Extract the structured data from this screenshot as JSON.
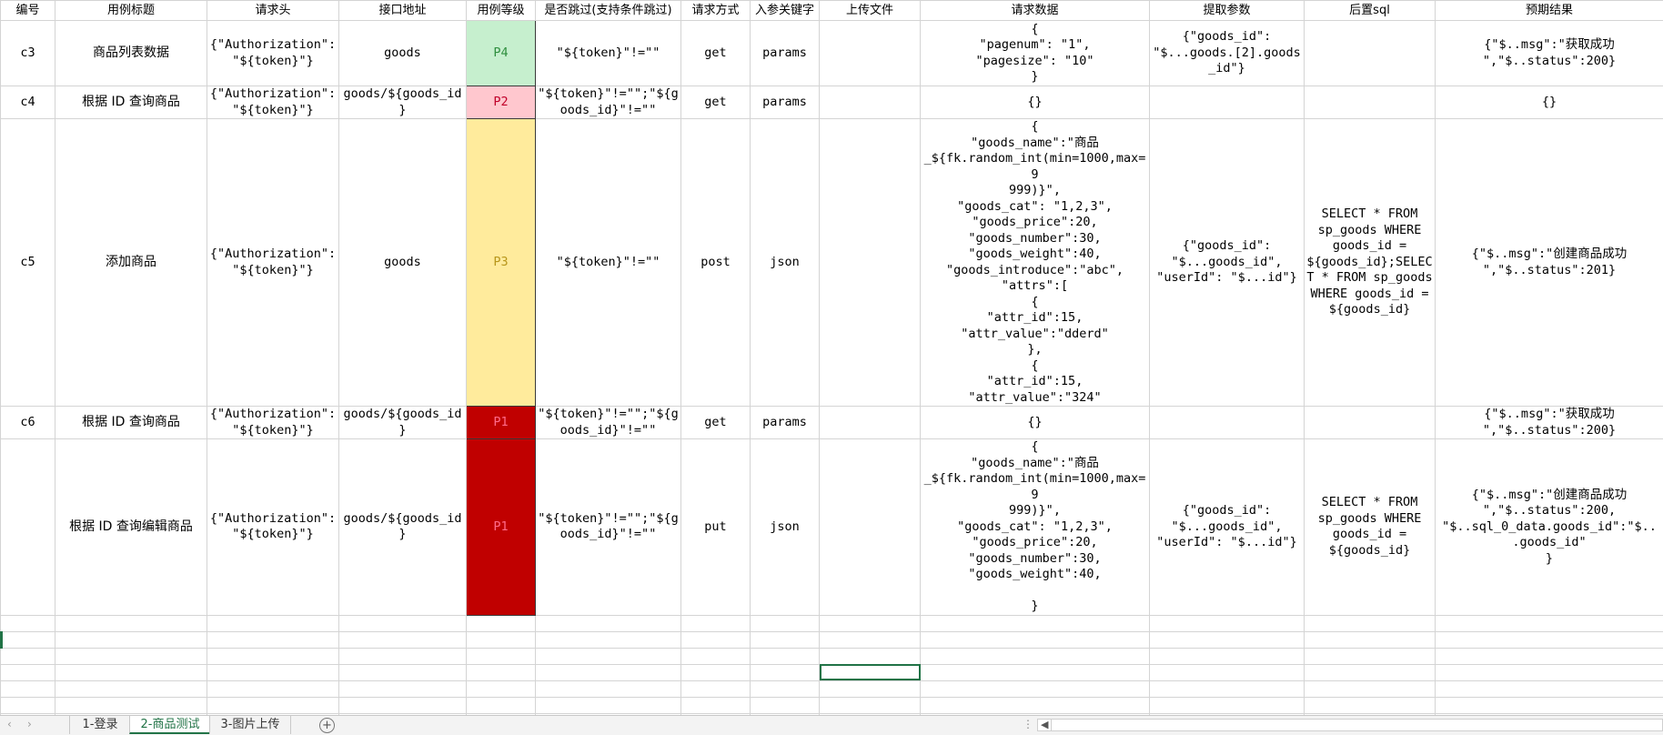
{
  "headers": {
    "id": "编号",
    "title": "用例标题",
    "req_header": "请求头",
    "url": "接口地址",
    "level": "用例等级",
    "skip": "是否跳过(支持条件跳过)",
    "method": "请求方式",
    "param_key": "入参关键字",
    "upload": "上传文件",
    "req_data": "请求数据",
    "extract": "提取参数",
    "post_sql": "后置sql",
    "expected": "预期结果"
  },
  "rows": [
    {
      "id": "c3",
      "title": "商品列表数据",
      "req_header": "{\"Authorization\":\n\"${token}\"}",
      "url": "goods",
      "level": "P4",
      "level_bg": "#c6efce",
      "level_fg": "#2f8f3f",
      "skip": "\"${token}\"!=\"\"",
      "method": "get",
      "param_key": "params",
      "upload": "",
      "req_data": "{\n\"pagenum\": \"1\",\n\"pagesize\": \"10\"\n}",
      "extract": "{\"goods_id\":\n\"$...goods.[2].goods\n_id\"}",
      "post_sql": "",
      "expected": "{\"$..msg\":\"获取成功\n\",\"$..status\":200}"
    },
    {
      "id": "c4",
      "title": "根据 ID 查询商品",
      "req_header": "{\"Authorization\":\n\"${token}\"}",
      "url": "goods/${goods_id\n}",
      "level": "P2",
      "level_bg": "#ffc7ce",
      "level_fg": "#c0002a",
      "skip": "\"${token}\"!=\"\";\"${g\noods_id}\"!=\"\"",
      "method": "get",
      "param_key": "params",
      "upload": "",
      "req_data": "{}",
      "extract": "",
      "post_sql": "",
      "expected": "{}"
    },
    {
      "id": "c5",
      "title": "添加商品",
      "req_header": "{\"Authorization\":\n\"${token}\"}",
      "url": "goods",
      "level": "P3",
      "level_bg": "#ffeb9c",
      "level_fg": "#b8961b",
      "skip": "\"${token}\"!=\"\"",
      "method": "post",
      "param_key": "json",
      "upload": "",
      "req_data": "{\n\"goods_name\":\"商品\n_${fk.random_int(min=1000,max=9\n999)}\",\n\"goods_cat\": \"1,2,3\",\n\"goods_price\":20,\n\"goods_number\":30,\n\"goods_weight\":40,\n\"goods_introduce\":\"abc\",\n\"attrs\":[\n{\n\"attr_id\":15,\n\"attr_value\":\"dderd\"\n},\n{\n\"attr_id\":15,\n\"attr_value\":\"324\"",
      "extract": "{\"goods_id\":\n\"$...goods_id\",\n\"userId\": \"$...id\"}",
      "post_sql": "SELECT * FROM\nsp_goods WHERE\ngoods_id =\n${goods_id};SELEC\nT * FROM sp_goods\nWHERE goods_id =\n${goods_id}",
      "expected": "{\"$..msg\":\"创建商品成功\n\",\"$..status\":201}"
    },
    {
      "id": "c6",
      "title": "根据 ID 查询商品",
      "req_header": "{\"Authorization\":\n\"${token}\"}",
      "url": "goods/${goods_id\n}",
      "level": "P1",
      "level_bg": "#c00000",
      "level_fg": "#ff6b8a",
      "skip": "\"${token}\"!=\"\";\"${g\noods_id}\"!=\"\"",
      "method": "get",
      "param_key": "params",
      "upload": "",
      "req_data": "{}",
      "extract": "",
      "post_sql": "",
      "expected": "{\"$..msg\":\"获取成功\n\",\"$..status\":200}"
    },
    {
      "id": "",
      "title": "根据 ID 查询编辑商品",
      "req_header": "{\"Authorization\":\n\"${token}\"}",
      "url": "goods/${goods_id\n}",
      "level": "P1",
      "level_bg": "#c00000",
      "level_fg": "#ff6b8a",
      "skip": "\"${token}\"!=\"\";\"${g\noods_id}\"!=\"\"",
      "method": "put",
      "param_key": "json",
      "upload": "",
      "req_data": "{\n\"goods_name\":\"商品\n_${fk.random_int(min=1000,max=9\n999)}\",\n\"goods_cat\": \"1,2,3\",\n\"goods_price\":20,\n\"goods_number\":30,\n\"goods_weight\":40,\n\n}",
      "extract": "{\"goods_id\":\n\"$...goods_id\",\n\"userId\": \"$...id\"}",
      "post_sql": "SELECT * FROM\nsp_goods WHERE\ngoods_id =\n${goods_id}",
      "expected": "{\"$..msg\":\"创建商品成功\n\",\"$..status\":200,\n\"$..sql_0_data.goods_id\":\"$..\n.goods_id\"\n}"
    }
  ],
  "tabs": {
    "t1": "1-登录",
    "t2": "2-商品测试",
    "t3": "3-图片上传",
    "add": "+",
    "scroll_marker": "⋮",
    "left_arrow": "◀"
  },
  "colors": {
    "accent": "#217346",
    "gridline": "#d4d4d4"
  }
}
